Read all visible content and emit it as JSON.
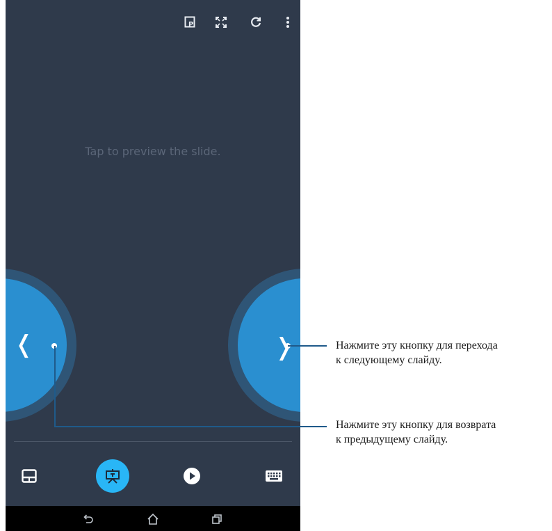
{
  "app": {
    "preview_hint": "Tap to preview the slide.",
    "top_icons": [
      "presentation-picker-icon",
      "fullscreen-icon",
      "refresh-icon",
      "more-vert-icon"
    ],
    "prev_button": {
      "glyph": "❬"
    },
    "next_button": {
      "glyph": "❭"
    },
    "bottom_icons": [
      "touchpad-icon",
      "presentation-icon",
      "play-icon",
      "keyboard-icon"
    ],
    "nav_icons": [
      "back-icon",
      "home-icon",
      "recents-icon"
    ]
  },
  "callouts": {
    "next": {
      "line1": "Нажмите эту кнопку для перехода",
      "line2": "к следующему слайду."
    },
    "prev": {
      "line1": "Нажмите эту кнопку для возврата",
      "line2": "к предыдущему слайду."
    }
  },
  "colors": {
    "screen_bg": "#2f3a4b",
    "button_blue": "#2a8fd0",
    "active_blue": "#29b6f6",
    "callout_line": "#1f5a8a"
  }
}
